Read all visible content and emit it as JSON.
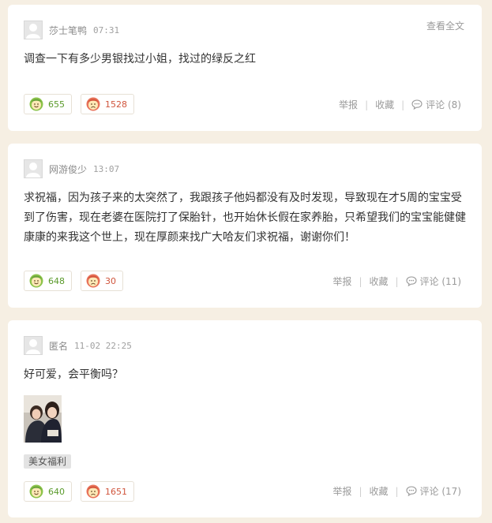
{
  "posts": [
    {
      "username": "莎士笔鸭",
      "time": "07:31",
      "full_text_label": "查看全文",
      "content": "调查一下有多少男银找过小姐，找过的绿反之红",
      "up_count": "655",
      "down_count": "1528",
      "report_label": "举报",
      "favorite_label": "收藏",
      "comment_label": "评论 (8)"
    },
    {
      "username": "网游俊少",
      "time": "13:07",
      "content": "求祝福，因为孩子来的太突然了，我跟孩子他妈都没有及时发现，导致现在才5周的宝宝受到了伤害，现在老婆在医院打了保胎针，也开始休长假在家养胎，只希望我们的宝宝能健健康康的来我这个世上，现在厚颜来找广大哈友们求祝福，谢谢你们！",
      "up_count": "648",
      "down_count": "30",
      "report_label": "举报",
      "favorite_label": "收藏",
      "comment_label": "评论 (11)"
    },
    {
      "username": "匿名",
      "time": "11-02 22:25",
      "content": "好可爱，会平衡吗？",
      "tag": "美女福利",
      "up_count": "640",
      "down_count": "1651",
      "report_label": "举报",
      "favorite_label": "收藏",
      "comment_label": "评论 (17)"
    }
  ],
  "icons": {
    "up": "smile-face-icon",
    "down": "frown-face-icon",
    "comment": "comment-bubble-icon",
    "avatar": "default-avatar-icon"
  },
  "colors": {
    "background": "#f6efe3",
    "up_green": "#5a9a2a",
    "down_red": "#d0553c",
    "muted": "#9a9a9a"
  }
}
